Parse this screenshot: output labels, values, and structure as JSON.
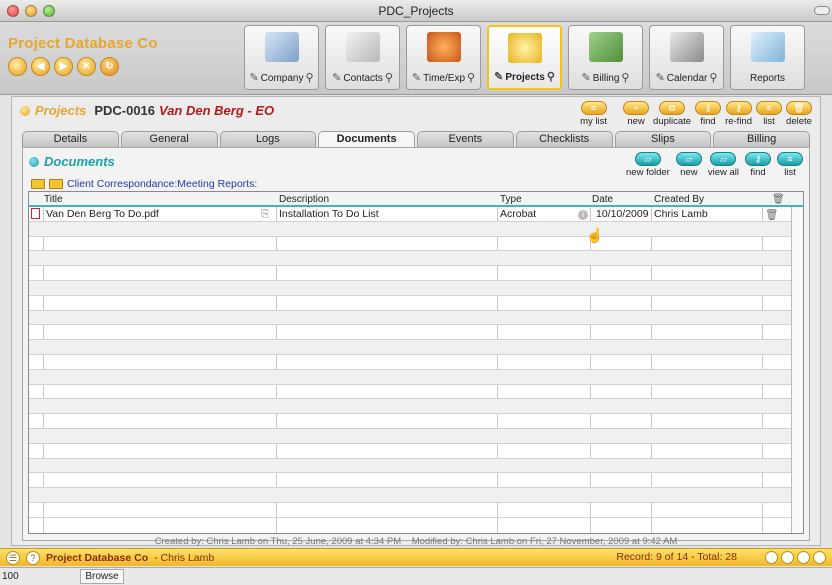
{
  "window": {
    "title": "PDC_Projects"
  },
  "header": {
    "brand": "Project Database Co",
    "nav_buttons": [
      "home",
      "back",
      "forward",
      "close",
      "refresh"
    ],
    "modules": [
      {
        "label": "Company",
        "icon": "building-icon"
      },
      {
        "label": "Contacts",
        "icon": "phone-icon"
      },
      {
        "label": "Time/Exp",
        "icon": "clock-icon"
      },
      {
        "label": "Projects",
        "icon": "hard-hat-icon",
        "active": true
      },
      {
        "label": "Billing",
        "icon": "money-icon"
      },
      {
        "label": "Calendar",
        "icon": "calendar-icon"
      },
      {
        "label": "Reports",
        "icon": "report-icon"
      }
    ]
  },
  "project": {
    "label": "Projects",
    "code": "PDC-0016",
    "title": "Van Den Berg - EO",
    "actions": [
      "my list",
      "new",
      "duplicate",
      "find",
      "re-find",
      "list",
      "delete"
    ]
  },
  "tabs": [
    "Details",
    "General",
    "Logs",
    "Documents",
    "Events",
    "Checklists",
    "Slips",
    "Billing"
  ],
  "documents": {
    "title": "Documents",
    "actions": [
      "new folder",
      "new",
      "view all",
      "find",
      "list"
    ],
    "breadcrumb": "Client Correspondance:Meeting Reports:",
    "columns": [
      "Title",
      "Description",
      "Type",
      "Date",
      "Created By"
    ],
    "rows": [
      {
        "title": "Van Den Berg To Do.pdf",
        "description": "Installation To Do List",
        "type": "Acrobat",
        "date": "10/10/2009",
        "created_by": "Chris Lamb"
      }
    ],
    "empty_rows": 20
  },
  "footer": {
    "created": "Created by: Chris Lamb on Thu, 25 June, 2009 at 4:34 PM",
    "modified": "Modified by: Chris Lamb on Fri, 27 November, 2009 at 9:42 AM"
  },
  "statusbar": {
    "company": "Project Database Co",
    "user": "- Chris Lamb",
    "record": "Record: 9 of 14 - Total: 28"
  },
  "modebar": {
    "zoom": "100",
    "mode": "Browse"
  },
  "colors": {
    "gold": "#e6a52e",
    "teal": "#1aa3a8",
    "red": "#b51a1a"
  }
}
